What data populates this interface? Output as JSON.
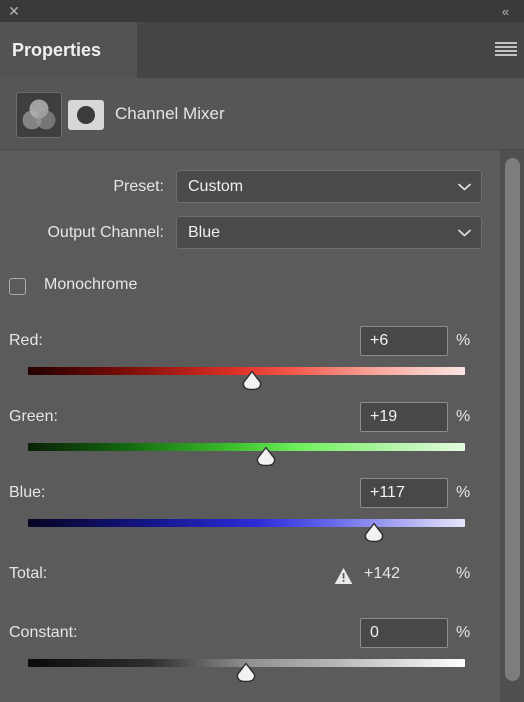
{
  "window": {
    "close_icon": "close-icon",
    "collapse_icon": "collapse-to-icons-icon",
    "collapse_glyph": "«",
    "close_glyph": "✕"
  },
  "tabs": [
    {
      "label": "Properties",
      "active": true
    }
  ],
  "panel_menu": {
    "icon": "panel-menu-icon"
  },
  "adjustment": {
    "title": "Channel Mixer",
    "icon": "channel-mixer-icon",
    "mask_icon": "layer-mask-thumbnail"
  },
  "fields": {
    "preset": {
      "label": "Preset:",
      "value": "Custom"
    },
    "output_channel": {
      "label": "Output Channel:",
      "value": "Blue"
    },
    "monochrome": {
      "label": "Monochrome",
      "checked": false
    }
  },
  "sliders": [
    {
      "label": "Red:",
      "value": "+6",
      "percent": "%",
      "thumb_pct": 51.3,
      "ramp": "red"
    },
    {
      "label": "Green:",
      "value": "+19",
      "percent": "%",
      "thumb_pct": 54.5,
      "ramp": "green"
    },
    {
      "label": "Blue:",
      "value": "+117",
      "percent": "%",
      "thumb_pct": 79.2,
      "ramp": "blue"
    }
  ],
  "total": {
    "label": "Total:",
    "value": "+142",
    "percent": "%",
    "warning_icon": "warning-triangle-icon"
  },
  "constant": {
    "label": "Constant:",
    "value": "0",
    "percent": "%",
    "thumb_pct": 49.9,
    "ramp": "gray"
  },
  "colors": {
    "panel_bg": "#5b5b5b",
    "header_bg": "#565656",
    "tabbar_bg": "#454545",
    "topbar_bg": "#3a3a3a",
    "text": "#e8e8e8",
    "input_bg": "#484848",
    "scrollbar": "#7d7d7d"
  }
}
